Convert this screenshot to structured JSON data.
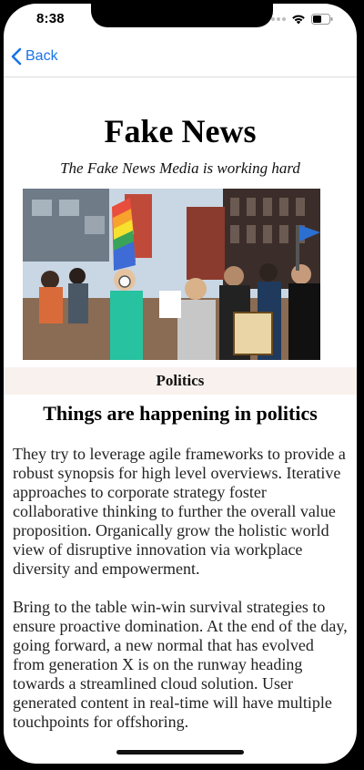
{
  "status_bar": {
    "time": "8:38"
  },
  "nav": {
    "back_label": "Back"
  },
  "article": {
    "masthead": "Fake News",
    "tagline": "The Fake News Media is working hard",
    "category": "Politics",
    "headline": "Things are happening in politics",
    "paragraphs": [
      "They try to leverage agile frameworks to provide a robust synopsis for high level overviews. Iterative approaches to corporate strategy foster collaborative thinking to further the overall value proposition. Organically grow the holistic world view of disruptive innovation via workplace diversity and empowerment.",
      "Bring to the table win-win survival strategies to ensure proactive domination. At the end of the day, going forward, a new normal that has evolved from generation X is on the runway heading towards a streamlined cloud solution. User generated content in real-time will have multiple touchpoints for offshoring."
    ]
  },
  "colors": {
    "link_blue": "#1a73e8",
    "category_bg": "#f8f1ee"
  },
  "icons": {
    "back": "chevron-left-icon",
    "wifi": "wifi-icon",
    "battery": "battery-icon",
    "signal": "cellular-signal-icon"
  }
}
